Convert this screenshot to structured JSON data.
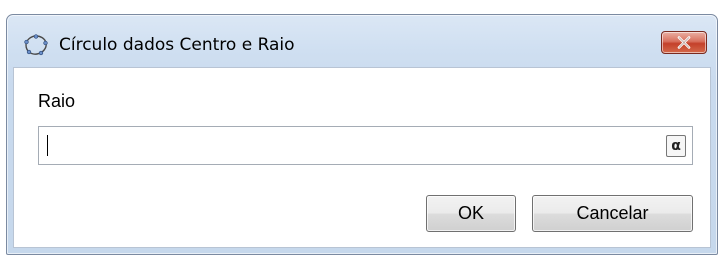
{
  "dialog": {
    "title": "Círculo dados Centro e Raio",
    "icon": "circle-tool-icon",
    "close_icon": "close-icon"
  },
  "field": {
    "label": "Raio",
    "value": "",
    "symbol_button": "α"
  },
  "buttons": {
    "ok_label": "OK",
    "cancel_label": "Cancelar"
  },
  "colors": {
    "title_bar": "#cfdff1",
    "close_button": "#c4402a",
    "content_background": "#ffffff"
  }
}
